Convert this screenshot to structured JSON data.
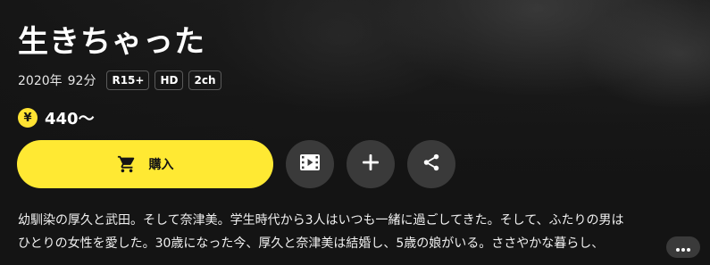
{
  "title": "生きちゃった",
  "meta": {
    "year": "2020年",
    "duration": "92分",
    "badges": [
      "R15+",
      "HD",
      "2ch"
    ]
  },
  "price": {
    "currency_symbol": "¥",
    "text": "440〜"
  },
  "actions": {
    "buy_label": "購入",
    "icons": {
      "buy": "cart-icon",
      "trailer": "film-icon",
      "add": "plus-icon",
      "share": "share-icon",
      "more": "more-dots-icon"
    }
  },
  "description": {
    "line1": "幼馴染の厚久と武田。そして奈津美。学生時代から3人はいつも一緒に過ごしてきた。そして、ふたりの男は",
    "line2": "ひとりの女性を愛した。30歳になった今、厚久と奈津美は結婚し、5歳の娘がいる。ささやかな暮らし、"
  },
  "colors": {
    "accent": "#ffe933",
    "background": "#141414",
    "button_dark": "#3a3a3a"
  }
}
